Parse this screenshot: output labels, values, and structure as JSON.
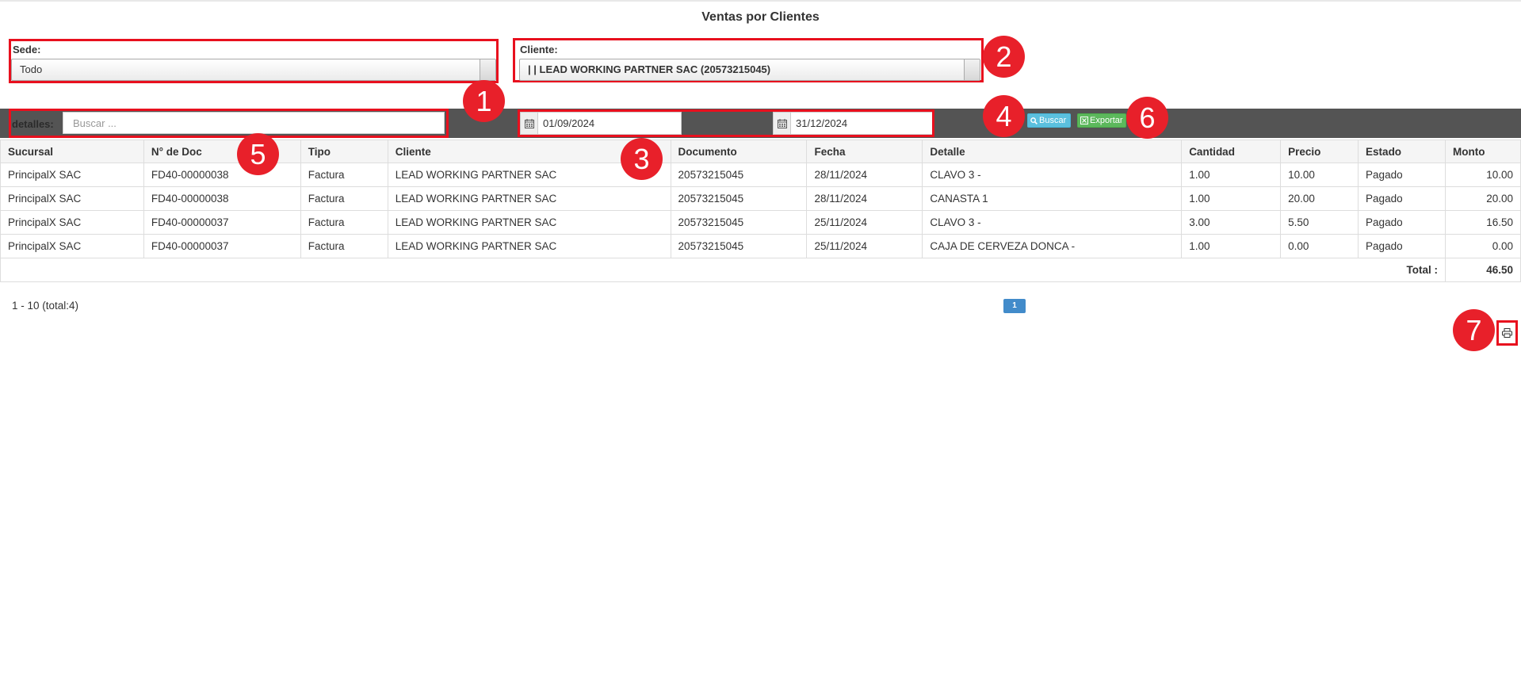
{
  "page": {
    "title": "Ventas por Clientes"
  },
  "filters": {
    "sede": {
      "label": "Sede:",
      "value": "Todo"
    },
    "cliente": {
      "label": "Cliente:",
      "value": "| | LEAD WORKING PARTNER SAC (20573215045)"
    }
  },
  "toolbar": {
    "details_label": "detalles:",
    "search_placeholder": "Buscar ...",
    "date_from": "01/09/2024",
    "date_to": "31/12/2024",
    "buscar_label": "Buscar",
    "exportar_label": "Exportar"
  },
  "table": {
    "columns": [
      "Sucursal",
      "N° de Doc",
      "Tipo",
      "Cliente",
      "Documento",
      "Fecha",
      "Detalle",
      "Cantidad",
      "Precio",
      "Estado",
      "Monto"
    ],
    "rows": [
      [
        "PrincipalX SAC",
        "FD40-00000038",
        "Factura",
        "LEAD WORKING PARTNER SAC",
        "20573215045",
        "28/11/2024",
        "CLAVO 3 -",
        "1.00",
        "10.00",
        "Pagado",
        "10.00"
      ],
      [
        "PrincipalX SAC",
        "FD40-00000038",
        "Factura",
        "LEAD WORKING PARTNER SAC",
        "20573215045",
        "28/11/2024",
        "CANASTA 1",
        "1.00",
        "20.00",
        "Pagado",
        "20.00"
      ],
      [
        "PrincipalX SAC",
        "FD40-00000037",
        "Factura",
        "LEAD WORKING PARTNER SAC",
        "20573215045",
        "25/11/2024",
        "CLAVO 3 -",
        "3.00",
        "5.50",
        "Pagado",
        "16.50"
      ],
      [
        "PrincipalX SAC",
        "FD40-00000037",
        "Factura",
        "LEAD WORKING PARTNER SAC",
        "20573215045",
        "25/11/2024",
        "CAJA DE CERVEZA DONCA -",
        "1.00",
        "0.00",
        "Pagado",
        "0.00"
      ]
    ],
    "total_label": "Total :",
    "total_value": "46.50"
  },
  "pagination": {
    "info": "1 - 10 (total:4)",
    "current_page": "1"
  },
  "annotations": [
    "1",
    "2",
    "3",
    "4",
    "5",
    "6",
    "7"
  ],
  "colors": {
    "annotation_red": "#e8202a",
    "toolbar_bg": "#545454",
    "buscar_btn": "#5bc0de",
    "exportar_btn": "#5cb85c",
    "page_btn": "#428bca"
  },
  "icons": [
    "calendar-icon",
    "search-icon",
    "excel-icon",
    "print-icon"
  ]
}
